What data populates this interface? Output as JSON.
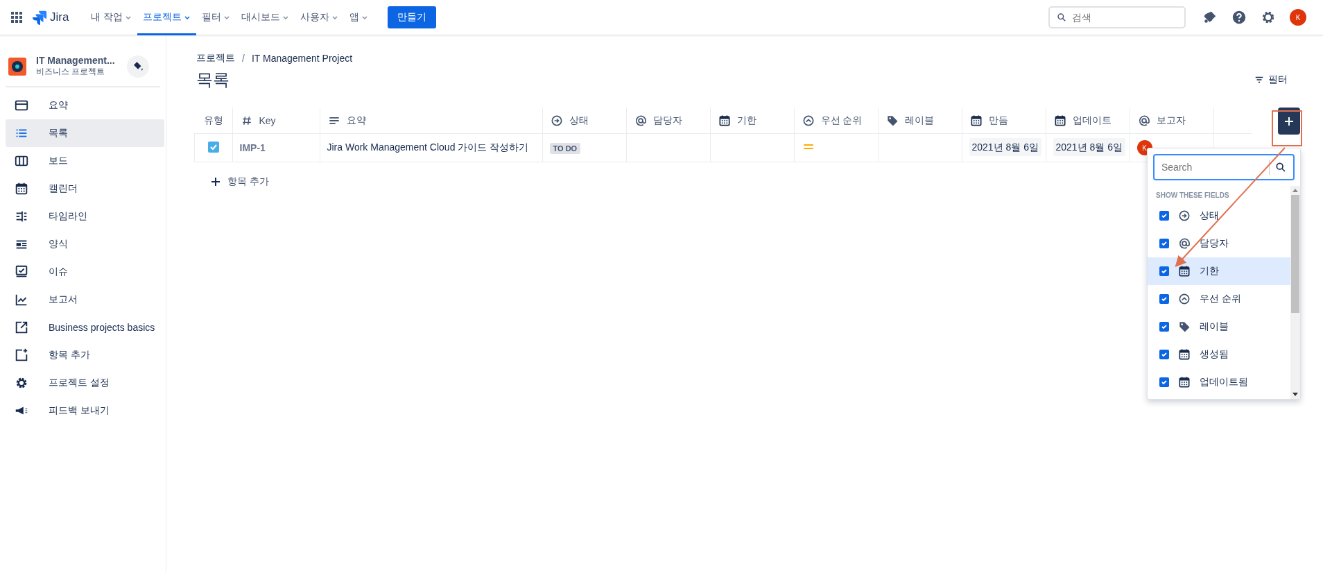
{
  "top_bar": {
    "product": "Jira",
    "nav": [
      {
        "label": "내 작업",
        "selected": false
      },
      {
        "label": "프로젝트",
        "selected": true
      },
      {
        "label": "필터",
        "selected": false
      },
      {
        "label": "대시보드",
        "selected": false
      },
      {
        "label": "사용자",
        "selected": false
      },
      {
        "label": "앱",
        "selected": false
      }
    ],
    "create_button": "만들기",
    "search": {
      "placeholder": "검색"
    },
    "avatar": "K"
  },
  "sidebar": {
    "project": {
      "name": "IT Management...",
      "type": "비즈니스 프로젝트"
    },
    "items": [
      {
        "label": "요약",
        "kind": "summary",
        "selected": false
      },
      {
        "label": "목록",
        "kind": "list",
        "selected": true
      },
      {
        "label": "보드",
        "kind": "board",
        "selected": false
      },
      {
        "label": "캘린더",
        "kind": "calendar",
        "selected": false
      },
      {
        "label": "타임라인",
        "kind": "timeline",
        "selected": false
      },
      {
        "label": "양식",
        "kind": "form",
        "selected": false
      },
      {
        "label": "이슈",
        "kind": "issue",
        "selected": false
      },
      {
        "label": "보고서",
        "kind": "report",
        "selected": false
      },
      {
        "label": "Business projects basics",
        "kind": "external",
        "selected": false
      },
      {
        "label": "항목 추가",
        "kind": "add",
        "selected": false
      },
      {
        "label": "프로젝트 설정",
        "kind": "gear",
        "selected": false
      },
      {
        "label": "피드백 보내기",
        "kind": "megaphone",
        "selected": false
      }
    ]
  },
  "breadcrumbs": {
    "separator": "/",
    "items": [
      "프로젝트",
      "IT Management Project"
    ]
  },
  "title": "목록",
  "filter_button": "필터",
  "table": {
    "columns": [
      {
        "label": "유형",
        "kind": "none"
      },
      {
        "label": "Key",
        "kind": "hash"
      },
      {
        "label": "요약",
        "kind": "lines"
      },
      {
        "label": "상태",
        "kind": "arrow"
      },
      {
        "label": "담당자",
        "kind": "at"
      },
      {
        "label": "기한",
        "kind": "calendar"
      },
      {
        "label": "우선 순위",
        "kind": "chevron"
      },
      {
        "label": "레이블",
        "kind": "tag"
      },
      {
        "label": "만듬",
        "kind": "calendar"
      },
      {
        "label": "업데이트",
        "kind": "calendar"
      },
      {
        "label": "보고자",
        "kind": "at"
      }
    ],
    "rows": [
      {
        "cells": [
          {
            "kind": "type"
          },
          {
            "kind": "key",
            "text": "IMP-1"
          },
          {
            "kind": "text",
            "text": "Jira Work Management Cloud 가이드 작성하기"
          },
          {
            "kind": "status",
            "text": "TO DO"
          },
          {
            "kind": "empty"
          },
          {
            "kind": "empty"
          },
          {
            "kind": "priority"
          },
          {
            "kind": "empty"
          },
          {
            "kind": "date",
            "text": "2021년 8월 6일"
          },
          {
            "kind": "date",
            "text": "2021년 8월 6일"
          },
          {
            "kind": "avatar",
            "text": "K"
          }
        ]
      }
    ],
    "add_item": "항목 추가"
  },
  "field_picker": {
    "search": {
      "placeholder": "Search"
    },
    "heading": "SHOW THESE FIELDS",
    "items": [
      {
        "label": "상태",
        "kind": "arrow",
        "checked": true,
        "selected": false
      },
      {
        "label": "담당자",
        "kind": "at",
        "checked": true,
        "selected": false
      },
      {
        "label": "기한",
        "kind": "calendar",
        "checked": true,
        "selected": true
      },
      {
        "label": "우선 순위",
        "kind": "chevron",
        "checked": true,
        "selected": false
      },
      {
        "label": "레이블",
        "kind": "tag",
        "checked": true,
        "selected": false
      },
      {
        "label": "생성됨",
        "kind": "calendar",
        "checked": true,
        "selected": false
      },
      {
        "label": "업데이트됨",
        "kind": "calendar",
        "checked": true,
        "selected": false
      }
    ]
  }
}
